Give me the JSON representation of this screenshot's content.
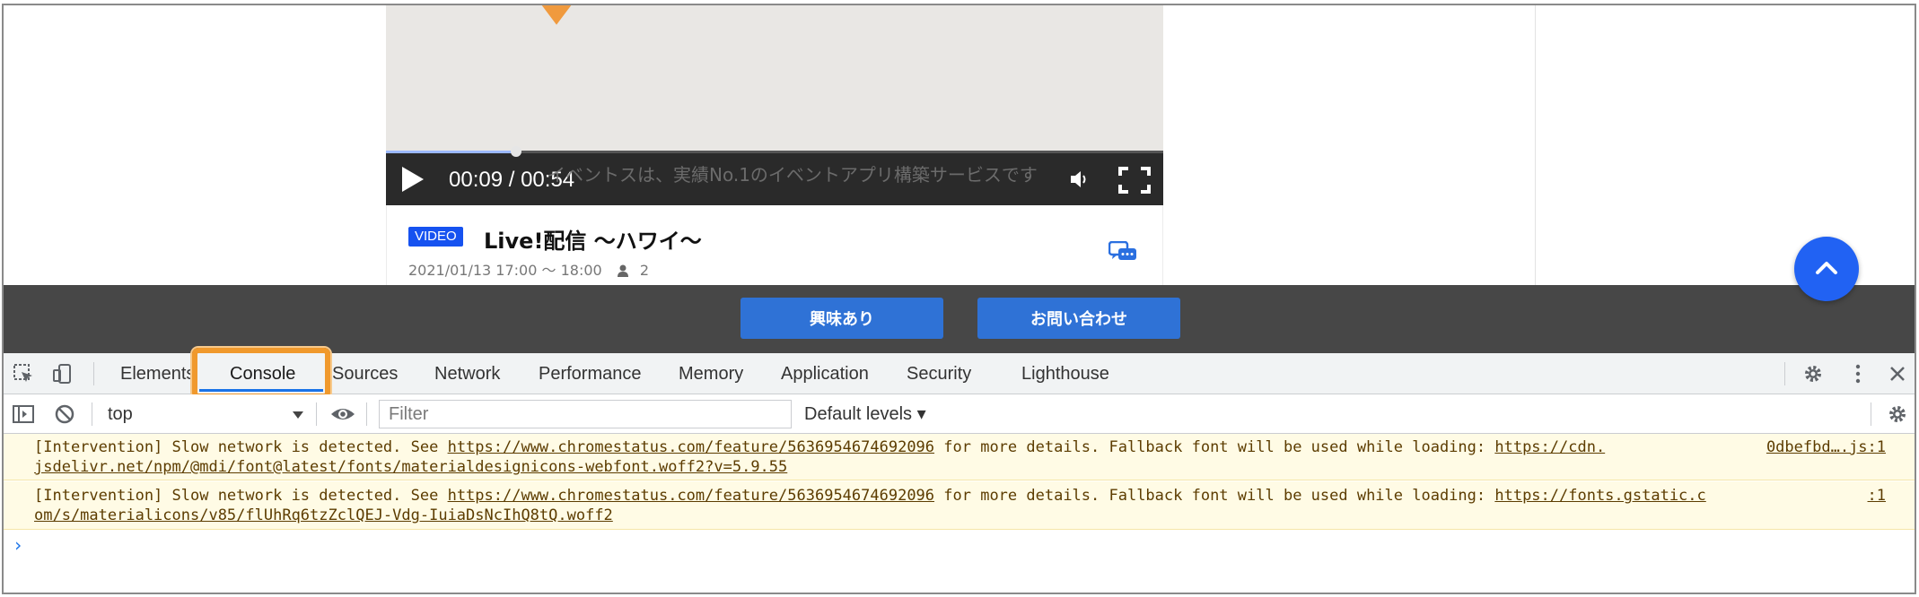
{
  "video": {
    "current_time": "00:09",
    "duration": "00:54",
    "time_separator": " / ",
    "caption": "イベントスは、実績No.1のイベントアプリ構築サービスです",
    "progress": 0.167
  },
  "card": {
    "badge": "VIDEO",
    "title": "Live!配信 〜ハワイ〜",
    "datetime": "2021/01/13 17:00 〜 18:00",
    "attendee_count": "2"
  },
  "cta": {
    "interest": "興味あり",
    "contact": "お問い合わせ"
  },
  "devtools": {
    "tabs": [
      {
        "label": "Elements"
      },
      {
        "label": "Console"
      },
      {
        "label": "Sources"
      },
      {
        "label": "Network"
      },
      {
        "label": "Performance"
      },
      {
        "label": "Memory"
      },
      {
        "label": "Application"
      },
      {
        "label": "Security"
      },
      {
        "label": "Lighthouse"
      }
    ],
    "active_tab": "Console",
    "context": "top",
    "filter_placeholder": "Filter",
    "levels": "Default levels ▾",
    "messages": [
      {
        "prefix": "[Intervention] Slow network is detected. See ",
        "link": "https://www.chromestatus.com/feature/5636954674692096",
        "middle": " for more details. Fallback font will be used while loading: ",
        "url_part1": "https://cdn.",
        "url_part2": "jsdelivr.net/npm/@mdi/font@latest/fonts/materialdesignicons-webfont.woff2?v=5.9.55",
        "source": "0dbefbd….js:1"
      },
      {
        "prefix": "[Intervention] Slow network is detected. See ",
        "link": "https://www.chromestatus.com/feature/5636954674692096",
        "middle": " for more details. Fallback font will be used while loading: ",
        "url_part1": "https://fonts.gstatic.c",
        "url_part2": "om/s/materialicons/v85/flUhRq6tzZclQEJ-Vdg-IuiaDsNcIhQ8tQ.woff2",
        "source": ":1"
      }
    ],
    "prompt": "›"
  }
}
